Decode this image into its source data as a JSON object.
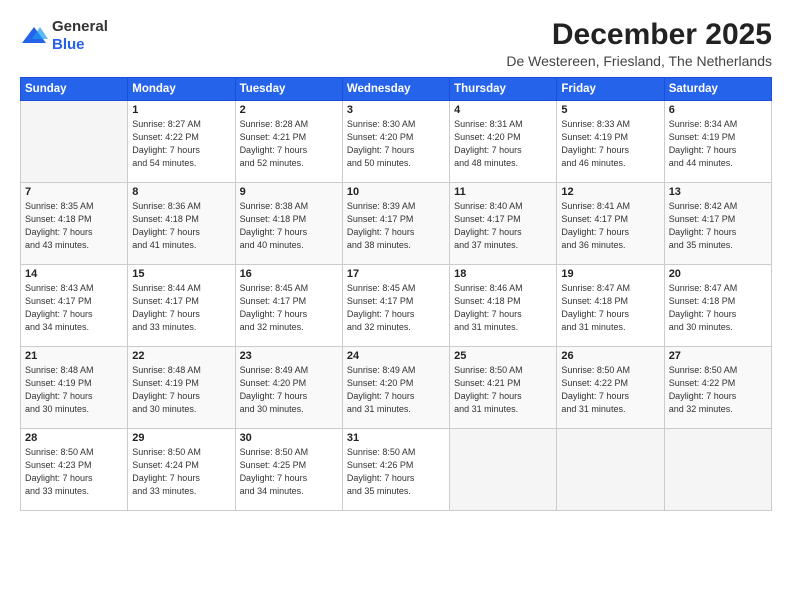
{
  "logo": {
    "general": "General",
    "blue": "Blue"
  },
  "title": "December 2025",
  "location": "De Westereen, Friesland, The Netherlands",
  "days_of_week": [
    "Sunday",
    "Monday",
    "Tuesday",
    "Wednesday",
    "Thursday",
    "Friday",
    "Saturday"
  ],
  "weeks": [
    [
      {
        "day": "",
        "info": ""
      },
      {
        "day": "1",
        "info": "Sunrise: 8:27 AM\nSunset: 4:22 PM\nDaylight: 7 hours\nand 54 minutes."
      },
      {
        "day": "2",
        "info": "Sunrise: 8:28 AM\nSunset: 4:21 PM\nDaylight: 7 hours\nand 52 minutes."
      },
      {
        "day": "3",
        "info": "Sunrise: 8:30 AM\nSunset: 4:20 PM\nDaylight: 7 hours\nand 50 minutes."
      },
      {
        "day": "4",
        "info": "Sunrise: 8:31 AM\nSunset: 4:20 PM\nDaylight: 7 hours\nand 48 minutes."
      },
      {
        "day": "5",
        "info": "Sunrise: 8:33 AM\nSunset: 4:19 PM\nDaylight: 7 hours\nand 46 minutes."
      },
      {
        "day": "6",
        "info": "Sunrise: 8:34 AM\nSunset: 4:19 PM\nDaylight: 7 hours\nand 44 minutes."
      }
    ],
    [
      {
        "day": "7",
        "info": "Sunrise: 8:35 AM\nSunset: 4:18 PM\nDaylight: 7 hours\nand 43 minutes."
      },
      {
        "day": "8",
        "info": "Sunrise: 8:36 AM\nSunset: 4:18 PM\nDaylight: 7 hours\nand 41 minutes."
      },
      {
        "day": "9",
        "info": "Sunrise: 8:38 AM\nSunset: 4:18 PM\nDaylight: 7 hours\nand 40 minutes."
      },
      {
        "day": "10",
        "info": "Sunrise: 8:39 AM\nSunset: 4:17 PM\nDaylight: 7 hours\nand 38 minutes."
      },
      {
        "day": "11",
        "info": "Sunrise: 8:40 AM\nSunset: 4:17 PM\nDaylight: 7 hours\nand 37 minutes."
      },
      {
        "day": "12",
        "info": "Sunrise: 8:41 AM\nSunset: 4:17 PM\nDaylight: 7 hours\nand 36 minutes."
      },
      {
        "day": "13",
        "info": "Sunrise: 8:42 AM\nSunset: 4:17 PM\nDaylight: 7 hours\nand 35 minutes."
      }
    ],
    [
      {
        "day": "14",
        "info": "Sunrise: 8:43 AM\nSunset: 4:17 PM\nDaylight: 7 hours\nand 34 minutes."
      },
      {
        "day": "15",
        "info": "Sunrise: 8:44 AM\nSunset: 4:17 PM\nDaylight: 7 hours\nand 33 minutes."
      },
      {
        "day": "16",
        "info": "Sunrise: 8:45 AM\nSunset: 4:17 PM\nDaylight: 7 hours\nand 32 minutes."
      },
      {
        "day": "17",
        "info": "Sunrise: 8:45 AM\nSunset: 4:17 PM\nDaylight: 7 hours\nand 32 minutes."
      },
      {
        "day": "18",
        "info": "Sunrise: 8:46 AM\nSunset: 4:18 PM\nDaylight: 7 hours\nand 31 minutes."
      },
      {
        "day": "19",
        "info": "Sunrise: 8:47 AM\nSunset: 4:18 PM\nDaylight: 7 hours\nand 31 minutes."
      },
      {
        "day": "20",
        "info": "Sunrise: 8:47 AM\nSunset: 4:18 PM\nDaylight: 7 hours\nand 30 minutes."
      }
    ],
    [
      {
        "day": "21",
        "info": "Sunrise: 8:48 AM\nSunset: 4:19 PM\nDaylight: 7 hours\nand 30 minutes."
      },
      {
        "day": "22",
        "info": "Sunrise: 8:48 AM\nSunset: 4:19 PM\nDaylight: 7 hours\nand 30 minutes."
      },
      {
        "day": "23",
        "info": "Sunrise: 8:49 AM\nSunset: 4:20 PM\nDaylight: 7 hours\nand 30 minutes."
      },
      {
        "day": "24",
        "info": "Sunrise: 8:49 AM\nSunset: 4:20 PM\nDaylight: 7 hours\nand 31 minutes."
      },
      {
        "day": "25",
        "info": "Sunrise: 8:50 AM\nSunset: 4:21 PM\nDaylight: 7 hours\nand 31 minutes."
      },
      {
        "day": "26",
        "info": "Sunrise: 8:50 AM\nSunset: 4:22 PM\nDaylight: 7 hours\nand 31 minutes."
      },
      {
        "day": "27",
        "info": "Sunrise: 8:50 AM\nSunset: 4:22 PM\nDaylight: 7 hours\nand 32 minutes."
      }
    ],
    [
      {
        "day": "28",
        "info": "Sunrise: 8:50 AM\nSunset: 4:23 PM\nDaylight: 7 hours\nand 33 minutes."
      },
      {
        "day": "29",
        "info": "Sunrise: 8:50 AM\nSunset: 4:24 PM\nDaylight: 7 hours\nand 33 minutes."
      },
      {
        "day": "30",
        "info": "Sunrise: 8:50 AM\nSunset: 4:25 PM\nDaylight: 7 hours\nand 34 minutes."
      },
      {
        "day": "31",
        "info": "Sunrise: 8:50 AM\nSunset: 4:26 PM\nDaylight: 7 hours\nand 35 minutes."
      },
      {
        "day": "",
        "info": ""
      },
      {
        "day": "",
        "info": ""
      },
      {
        "day": "",
        "info": ""
      }
    ]
  ]
}
